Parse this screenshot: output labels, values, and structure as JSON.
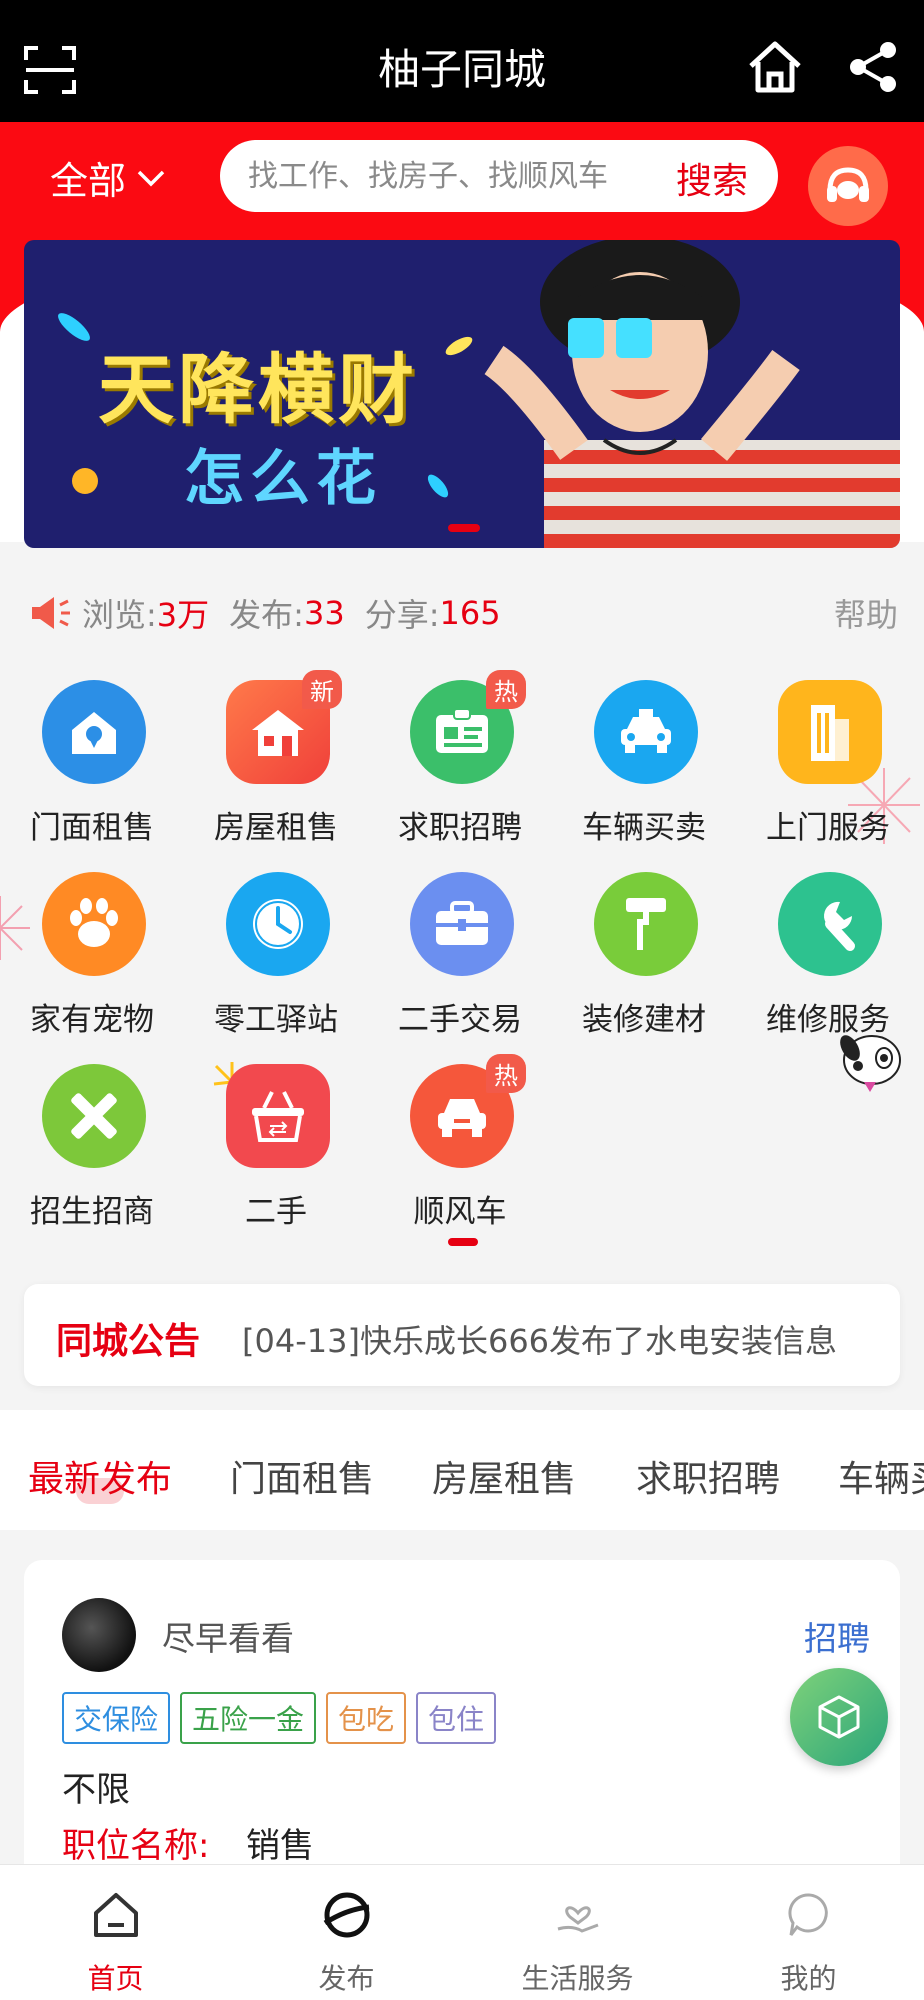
{
  "header": {
    "title": "柚子同城"
  },
  "search": {
    "city": "全部",
    "placeholder": "找工作、找房子、找顺风车",
    "button": "搜索"
  },
  "banner": {
    "line1": "天降横财",
    "line2": "怎么花"
  },
  "stats": {
    "views_label": "浏览:",
    "views": "3万",
    "posts_label": "发布:",
    "posts": "33",
    "shares_label": "分享:",
    "shares": "165",
    "help": "帮助"
  },
  "categories": [
    {
      "label": "门面租售",
      "color": "#2c8fe6",
      "icon": "shop-location-icon",
      "badge": ""
    },
    {
      "label": "房屋租售",
      "color": "#f5573b",
      "icon": "house-icon",
      "badge": "新"
    },
    {
      "label": "求职招聘",
      "color": "#3bbf6a",
      "icon": "id-card-icon",
      "badge": "热"
    },
    {
      "label": "车辆买卖",
      "color": "#1aa7f0",
      "icon": "taxi-icon",
      "badge": ""
    },
    {
      "label": "上门服务",
      "color": "#ffb51c",
      "icon": "building-icon",
      "badge": ""
    },
    {
      "label": "家有宠物",
      "color": "#ff8a24",
      "icon": "paw-icon",
      "badge": ""
    },
    {
      "label": "零工驿站",
      "color": "#1aa7f0",
      "icon": "clock-icon",
      "badge": ""
    },
    {
      "label": "二手交易",
      "color": "#6b8ff0",
      "icon": "briefcase-icon",
      "badge": ""
    },
    {
      "label": "装修建材",
      "color": "#79cc3a",
      "icon": "paint-roller-icon",
      "badge": ""
    },
    {
      "label": "维修服务",
      "color": "#2dc28f",
      "icon": "wrench-icon",
      "badge": ""
    },
    {
      "label": "招生招商",
      "color": "#7dc83a",
      "icon": "pencil-ruler-icon",
      "badge": ""
    },
    {
      "label": "二手",
      "color": "#f2494e",
      "icon": "basket-icon",
      "badge": ""
    },
    {
      "label": "顺风车",
      "color": "#f5573b",
      "icon": "car-icon",
      "badge": "热"
    }
  ],
  "notice": {
    "title": "同城公告",
    "message": "[04-13]快乐成长666发布了水电安装信息"
  },
  "tabs": [
    "最新发布",
    "门面租售",
    "房屋租售",
    "求职招聘",
    "车辆买卖"
  ],
  "listing": {
    "user": "尽早看看",
    "category": "招聘",
    "tags": [
      "交保险",
      "五险一金",
      "包吃",
      "包住"
    ],
    "requirement": "不限",
    "position_label": "职位名称:",
    "position": "销售"
  },
  "bottom_nav": [
    "首页",
    "发布",
    "生活服务",
    "我的"
  ],
  "colors": {
    "brand_red": "#fb0a12",
    "accent_red": "#e60012",
    "link_blue": "#3b6fd0"
  }
}
